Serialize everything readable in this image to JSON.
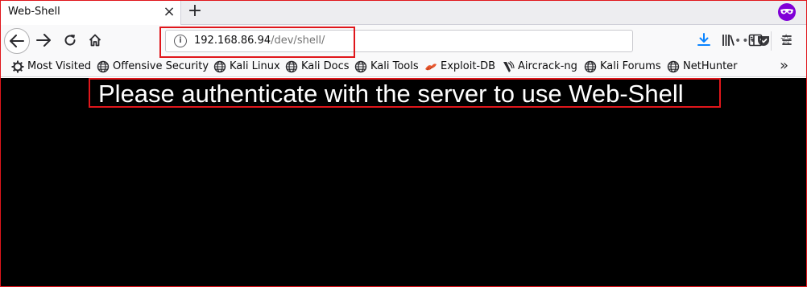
{
  "tab": {
    "title": "Web-Shell",
    "close_glyph": "×",
    "new_tab_glyph": "+"
  },
  "url": {
    "host": "192.168.86.94",
    "path": "/dev/shell/"
  },
  "icons": {
    "back": "back-arrow-icon",
    "forward": "forward-arrow-icon",
    "reload": "reload-icon",
    "home": "home-icon",
    "info": "info-icon",
    "page_actions": "more-horizontal-icon",
    "pocket": "pocket-icon",
    "bookmark": "star-icon",
    "downloads": "download-icon",
    "library": "library-icon",
    "sidebar": "sidebar-icon",
    "menu": "hamburger-menu-icon",
    "private": "private-browsing-mask-icon"
  },
  "colors": {
    "highlight": "#e0161b",
    "download_accent": "#0a84ff",
    "private_purple": "#8000d7",
    "content_bg": "#000000",
    "content_text": "#ffffff"
  },
  "bookmarks": {
    "items": [
      {
        "label": "Most Visited",
        "icon": "gear-icon"
      },
      {
        "label": "Offensive Security",
        "icon": "globe-icon"
      },
      {
        "label": "Kali Linux",
        "icon": "globe-icon"
      },
      {
        "label": "Kali Docs",
        "icon": "globe-icon"
      },
      {
        "label": "Kali Tools",
        "icon": "globe-icon"
      },
      {
        "label": "Exploit-DB",
        "icon": "exploit-db-icon"
      },
      {
        "label": "Aircrack-ng",
        "icon": "aircrack-icon"
      },
      {
        "label": "Kali Forums",
        "icon": "globe-icon"
      },
      {
        "label": "NetHunter",
        "icon": "globe-icon"
      }
    ],
    "overflow_glyph": "»"
  },
  "content": {
    "message": "Please authenticate with the server to use Web-Shell"
  }
}
